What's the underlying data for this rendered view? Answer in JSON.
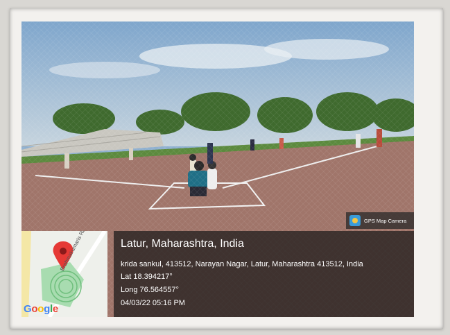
{
  "badge": {
    "text": "GPS Map Camera",
    "icon": "gps-map-camera-app-icon"
  },
  "map": {
    "provider": "Google",
    "road_label": "Brahmakumaris Rd",
    "pin_icon": "location-pin-icon",
    "pin_color": "#e53935"
  },
  "location": {
    "place": "Latur, Maharashtra, India",
    "address": "krida sankul, 413512, Narayan Nagar, Latur, Maharashtra 413512, India",
    "lat": "Lat 18.394217°",
    "long": "Long 76.564557°",
    "datetime": "04/03/22 05:16 PM"
  },
  "colors": {
    "overlay": "#191919",
    "field_dirt": "#a0756a",
    "grass": "#5c8a3e"
  }
}
